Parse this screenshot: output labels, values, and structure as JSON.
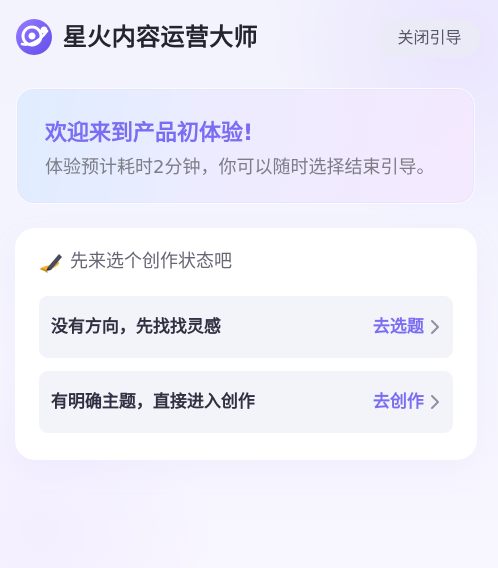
{
  "app": {
    "title": "星火内容运营大师",
    "logo_icon": "planet-logo-icon"
  },
  "header": {
    "close_guide_label": "关闭引导"
  },
  "welcome": {
    "title": "欢迎来到产品初体验!",
    "subtitle": "体验预计耗时2分钟，你可以随时选择结束引导。"
  },
  "mode_select": {
    "icon": "writing-hand-icon",
    "heading": "先来选个创作状态吧",
    "options": [
      {
        "label": "没有方向，先找找灵感",
        "action": "去选题",
        "action_icon": "chevron-right-icon"
      },
      {
        "label": "有明确主题，直接进入创作",
        "action": "去创作",
        "action_icon": "chevron-right-icon"
      }
    ]
  },
  "colors": {
    "accent": "#7a6df3",
    "page_background": "#f3f3fd",
    "card_background": "#ffffff",
    "option_background": "#f3f3fa"
  }
}
